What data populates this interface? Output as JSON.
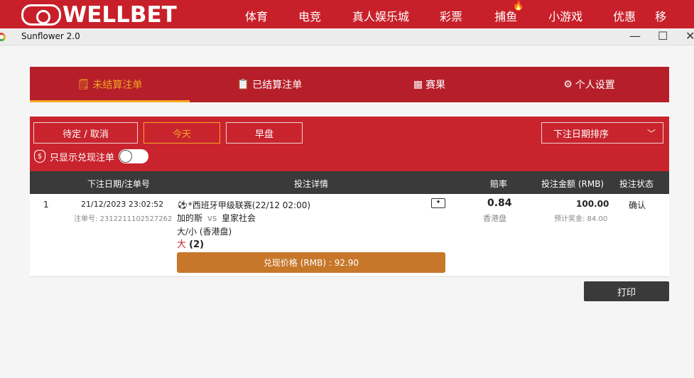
{
  "brand": {
    "logo_text": "WELLBET",
    "nav": [
      "体育",
      "电竞",
      "真人娱乐城",
      "彩票",
      "捕鱼",
      "小游戏",
      "优惠",
      "移"
    ]
  },
  "window": {
    "title": "Sunflower 2.0",
    "minimize": "—",
    "maximize": "☐",
    "close": "✕"
  },
  "tabs": [
    {
      "label": "未结算注单",
      "icon": "ticket-icon",
      "active": true
    },
    {
      "label": "已结算注单",
      "icon": "settled-icon",
      "active": false
    },
    {
      "label": "赛果",
      "icon": "scoreboard-icon",
      "active": false
    },
    {
      "label": "个人设置",
      "icon": "gear-icon",
      "active": false
    }
  ],
  "filters": {
    "pending": "待定 / 取消",
    "today": "今天",
    "early": "早盘",
    "sort": "下注日期排序",
    "cash_only": "只显示兑现注单"
  },
  "table": {
    "headers": {
      "date": "下注日期/注单号",
      "detail": "投注详情",
      "odds": "赔率",
      "amount": "投注金额 (RMB)",
      "status": "投注状态"
    },
    "rows": [
      {
        "index": "1",
        "datetime": "21/12/2023 23:02:52",
        "ticket": "注单号: 2312211102527262",
        "league": "*西班牙甲级联赛(22/12 02:00)",
        "home": "加的斯",
        "vs": "vs",
        "away": "皇家社会",
        "market": "大/小 (香港盘)",
        "selection": "大",
        "line": "(2)",
        "odds": "0.84",
        "odds_type": "香港盘",
        "stake": "100.00",
        "potential": "预计奖金: 84.00",
        "status": "确认",
        "cashout": "兑现价格 (RMB) : 92.90"
      }
    ]
  },
  "print": "打印",
  "colors": {
    "brand_red": "#c8202a",
    "tab_red": "#b61f2a",
    "accent_orange": "#f5a623",
    "cashout": "#c7772a",
    "header_dark": "#3a3a3a"
  }
}
